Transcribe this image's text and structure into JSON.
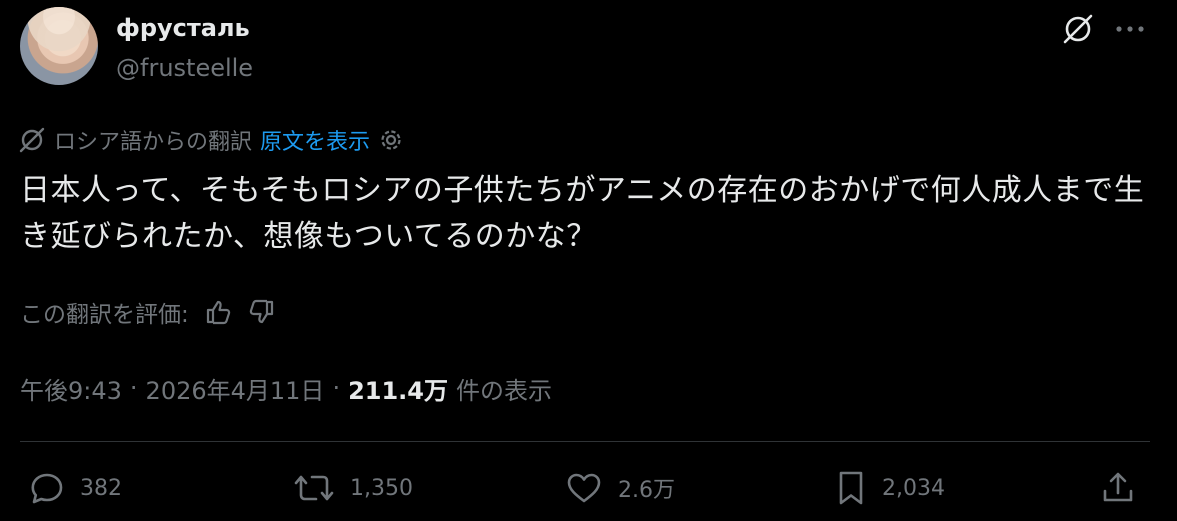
{
  "author": {
    "display_name": "фрусталь",
    "username": "@frusteelle"
  },
  "translation": {
    "source_label": "ロシア語からの翻訳",
    "show_original_label": "原文を表示"
  },
  "tweet": {
    "text": "日本人って、そもそもロシアの子供たちがアニメの存在のおかげで何人成人まで生き延びられたか、想像もついてるのかな？"
  },
  "rating": {
    "prompt": "この翻訳を評価:"
  },
  "meta": {
    "time": "午後9:43",
    "separator": "·",
    "date": "2026年4月11日",
    "views_count": "211.4万",
    "views_label": "件の表示"
  },
  "actions": {
    "replies": "382",
    "reposts": "1,350",
    "likes": "2.6万",
    "bookmarks": "2,034"
  },
  "colors": {
    "background": "#000000",
    "text": "#e7e9ea",
    "muted": "#71767b",
    "link": "#1d9bf0",
    "divider": "#2f3336"
  },
  "icons": [
    "grok-icon",
    "more-icon",
    "translate-icon",
    "settings-gear-icon",
    "thumbs-up-icon",
    "thumbs-down-icon",
    "reply-icon",
    "repost-icon",
    "like-icon",
    "bookmark-icon",
    "share-icon"
  ]
}
